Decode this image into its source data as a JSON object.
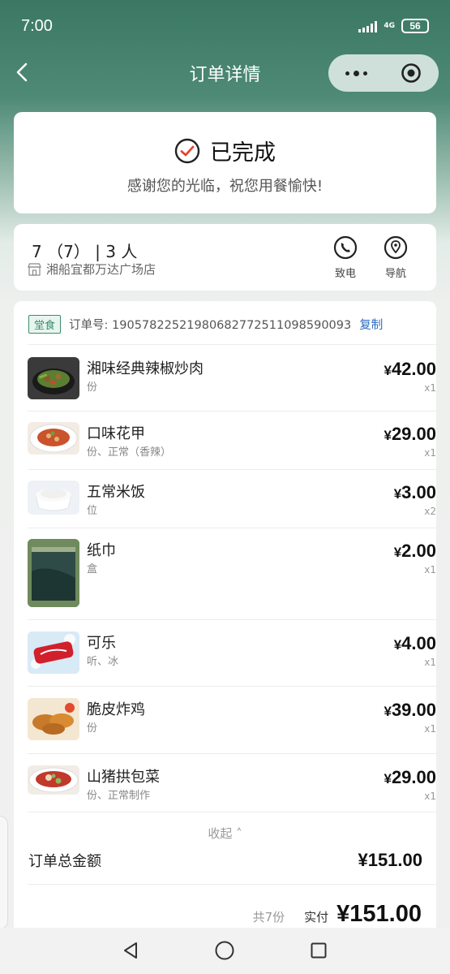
{
  "status_bar": {
    "time": "7:00",
    "network": "4G",
    "battery": "56"
  },
  "nav": {
    "title": "订单详情"
  },
  "status_card": {
    "status": "已完成",
    "message": "感谢您的光临，祝您用餐愉快!"
  },
  "store": {
    "table": "7 （7） | 3 人",
    "name": "湘船宜都万达广场店",
    "call_label": "致电",
    "navigate_label": "导航"
  },
  "order": {
    "dine_type": "堂食",
    "order_no_label": "订单号:",
    "order_no": "1905782252198068277251109859 0093",
    "copy_label": "复制",
    "items": [
      {
        "name": "湘味经典辣椒炒肉",
        "spec": "份",
        "price": "42.00",
        "qty": "x1"
      },
      {
        "name": "口味花甲",
        "spec": "份、正常（香辣）",
        "price": "29.00",
        "qty": "x1"
      },
      {
        "name": "五常米饭",
        "spec": "位",
        "price": "3.00",
        "qty": "x2"
      },
      {
        "name": "纸巾",
        "spec": "盒",
        "price": "2.00",
        "qty": "x1"
      },
      {
        "name": "可乐",
        "spec": "听、冰",
        "price": "4.00",
        "qty": "x1"
      },
      {
        "name": "脆皮炸鸡",
        "spec": "份",
        "price": "39.00",
        "qty": "x1"
      },
      {
        "name": "山猪拱包菜",
        "spec": "份、正常制作",
        "price": "29.00",
        "qty": "x1"
      }
    ],
    "currency": "¥",
    "collapse_label": "收起 ˄",
    "total_label": "订单总金额",
    "total_value": "¥151.00",
    "count_label": "共7份",
    "paid_label": "实付",
    "paid_value": "¥151.00"
  }
}
